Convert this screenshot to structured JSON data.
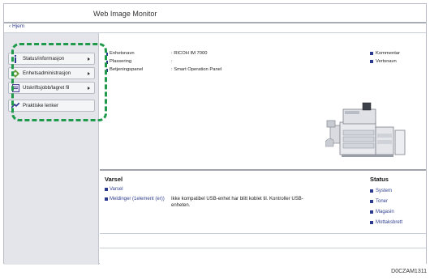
{
  "app": {
    "title": "Web Image Monitor"
  },
  "nav": {
    "home_label": "‹ Hjem"
  },
  "sidebar": {
    "items": [
      {
        "label": "Status/informasjon",
        "icon": "info-icon"
      },
      {
        "label": "Enhetsadministrasjon",
        "icon": "device-management-icon"
      },
      {
        "label": "Utskriftsjobb/lagret fil",
        "icon": "print-job-icon"
      },
      {
        "label": "Praktiske lenker",
        "icon": "link-icon"
      }
    ]
  },
  "device_info": {
    "rows": [
      {
        "key": "Enhetsnavn",
        "value": ": RICOH IM 7000"
      },
      {
        "key": "Plassering",
        "value": ":"
      },
      {
        "key": "Betjeningspanel",
        "value": ": Smart Operation Panel"
      }
    ]
  },
  "side_links": [
    "Kommentar",
    "Vertsnavn"
  ],
  "alerts": {
    "title": "Varsel",
    "link": "Varsel",
    "messages_link": "Meldinger (1element (er))",
    "message_text": "Ikke kompatibel USB-enhet har blitt koblet til. Kontroller USB-enheten."
  },
  "status": {
    "title": "Status",
    "links": [
      "System",
      "Toner",
      "Magasin",
      "Mottaksbrett"
    ]
  },
  "figure_code": "D0CZAM1311",
  "colors": {
    "highlight": "#1e9a4a",
    "link": "#2f3f8f",
    "sidebar_bg": "#e3e5ea"
  }
}
